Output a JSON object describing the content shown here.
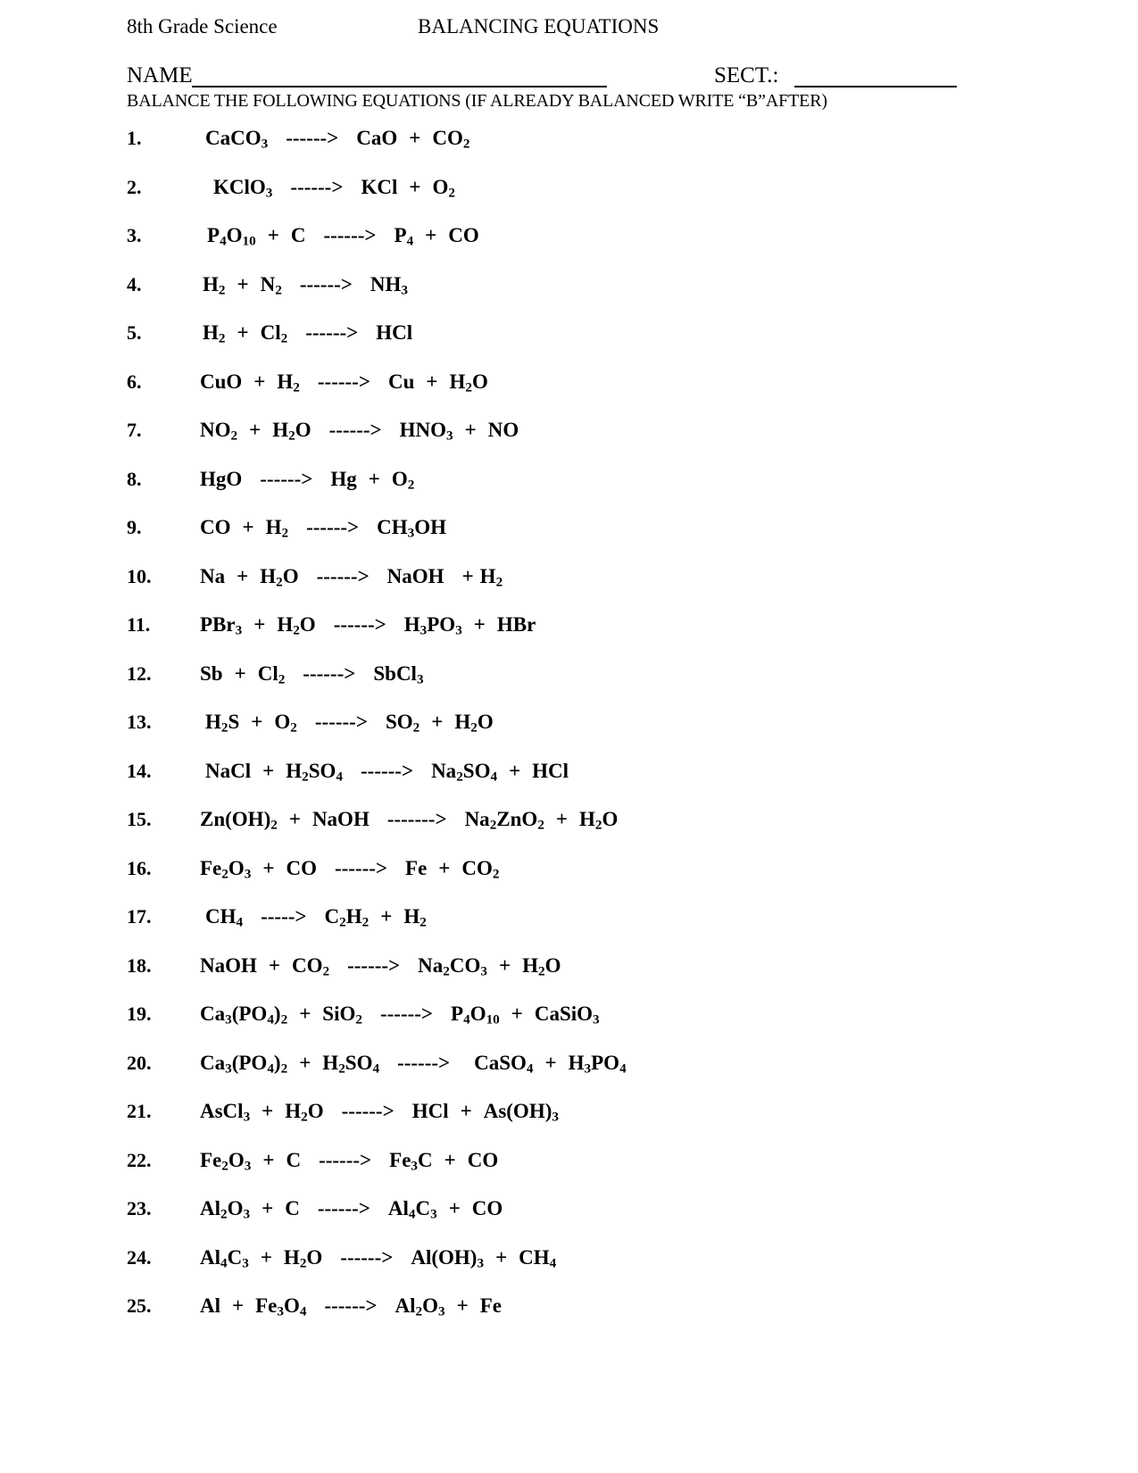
{
  "header": {
    "course": "8th Grade Science",
    "title": "BALANCING EQUATIONS",
    "name_label": "NAME",
    "sect_label": "SECT.:",
    "instructions": "BALANCE THE FOLLOWING EQUATIONS (IF ALREADY BALANCED WRITE “B”AFTER)"
  },
  "equations": [
    {
      "num": "1.",
      "indent": 88,
      "arrow": "------>",
      "html": "CaCO<sub>3</sub><span class=\"sp-lg\"></span><span class=\"arrow\">------&gt;</span><span class=\"sp-lg\"></span>CaO<span class=\"sp\"></span>+<span class=\"sp\"></span>CO<sub>2</sub>",
      "text": "CaCO3 ------> CaO + CO2"
    },
    {
      "num": "2.",
      "indent": 97,
      "arrow": "------>",
      "html": "KClO<sub>3</sub><span class=\"sp-lg\"></span><span class=\"arrow\">------&gt;</span><span class=\"sp-lg\"></span>KCl<span class=\"sp\"></span>+<span class=\"sp\"></span>O<sub>2</sub>",
      "text": "KClO3 ------> KCl + O2"
    },
    {
      "num": "3.",
      "indent": 90,
      "arrow": "------>",
      "html": "P<sub>4</sub>O<sub>10</sub><span class=\"sp\"></span>+<span class=\"sp\"></span>C<span class=\"sp-lg\"></span><span class=\"arrow\">------&gt;</span><span class=\"sp-lg\"></span>P<sub>4</sub><span class=\"sp\"></span>+<span class=\"sp\"></span>CO",
      "text": "P4O10 + C ------> P4 + CO"
    },
    {
      "num": "4.",
      "indent": 85,
      "arrow": "------>",
      "html": "H<sub>2</sub><span class=\"sp\"></span>+<span class=\"sp\"></span>N<sub>2</sub><span class=\"sp-lg\"></span><span class=\"arrow\">------&gt;</span><span class=\"sp-lg\"></span>NH<sub>3</sub>",
      "text": "H2 + N2 ------> NH3"
    },
    {
      "num": "5.",
      "indent": 85,
      "arrow": "------>",
      "html": "H<sub>2</sub><span class=\"sp\"></span>+<span class=\"sp\"></span>Cl<sub>2</sub><span class=\"sp-lg\"></span><span class=\"arrow\">------&gt;</span><span class=\"sp-lg\"></span>HCl",
      "text": "H2 + Cl2 ------> HCl"
    },
    {
      "num": "6.",
      "indent": 82,
      "arrow": "------>",
      "html": "CuO<span class=\"sp\"></span>+<span class=\"sp\"></span>H<sub>2</sub><span class=\"sp-lg\"></span><span class=\"arrow\">------&gt;</span><span class=\"sp-lg\"></span>Cu<span class=\"sp\"></span>+<span class=\"sp\"></span>H<sub>2</sub>O",
      "text": "CuO + H2 ------> Cu + H2O"
    },
    {
      "num": "7.",
      "indent": 82,
      "arrow": "------>",
      "html": "NO<sub>2</sub><span class=\"sp\"></span>+<span class=\"sp\"></span>H<sub>2</sub>O<span class=\"sp-lg\"></span><span class=\"arrow\">------&gt;</span><span class=\"sp-lg\"></span>HNO<sub>3</sub><span class=\"sp\"></span>+<span class=\"sp\"></span>NO",
      "text": "NO2 + H2O ------> HNO3 + NO"
    },
    {
      "num": "8.",
      "indent": 82,
      "arrow": "------>",
      "html": "HgO<span class=\"sp-lg\"></span><span class=\"arrow\">------&gt;</span><span class=\"sp-lg\"></span>Hg<span class=\"sp\"></span>+<span class=\"sp\"></span>O<sub>2</sub>",
      "text": "HgO ------> Hg + O2"
    },
    {
      "num": "9.",
      "indent": 82,
      "arrow": "------>",
      "html": "CO<span class=\"sp\"></span>+<span class=\"sp\"></span>H<sub>2</sub><span class=\"sp-lg\"></span><span class=\"arrow\">------&gt;</span><span class=\"sp-lg\"></span>CH<sub>3</sub>OH",
      "text": "CO + H2 ------> CH3OH"
    },
    {
      "num": "10.",
      "indent": 82,
      "arrow": "------>",
      "html": "Na<span class=\"sp\"></span>+<span class=\"sp\"></span>H<sub>2</sub>O<span class=\"sp-lg\"></span><span class=\"arrow\">------&gt;</span><span class=\"sp-lg\"></span>NaOH<span class=\"sp-lg\"></span>+<span class=\"sp-sm\"></span>H<sub>2</sub>",
      "text": "Na + H2O ------> NaOH + H2"
    },
    {
      "num": "11.",
      "indent": 82,
      "arrow": "------>",
      "html": "PBr<sub>3</sub><span class=\"sp\"></span>+<span class=\"sp\"></span>H<sub>2</sub>O<span class=\"sp-lg\"></span><span class=\"arrow\">------&gt;</span><span class=\"sp-lg\"></span>H<sub>3</sub>PO<sub>3</sub><span class=\"sp\"></span>+<span class=\"sp\"></span>HBr",
      "text": "PBr3 + H2O ------> H3PO3 + HBr"
    },
    {
      "num": "12.",
      "indent": 82,
      "arrow": "------>",
      "html": "Sb<span class=\"sp\"></span>+<span class=\"sp\"></span>Cl<sub>2</sub><span class=\"sp-lg\"></span><span class=\"arrow\">------&gt;</span><span class=\"sp-lg\"></span>SbCl<sub>3</sub>",
      "text": "Sb + Cl2 ------> SbCl3"
    },
    {
      "num": "13.",
      "indent": 88,
      "arrow": "------>",
      "html": "H<sub>2</sub>S<span class=\"sp\"></span>+<span class=\"sp\"></span>O<sub>2</sub><span class=\"sp-lg\"></span><span class=\"arrow\">------&gt;</span><span class=\"sp-lg\"></span>SO<sub>2</sub><span class=\"sp\"></span>+<span class=\"sp\"></span>H<sub>2</sub>O",
      "text": "H2S + O2 ------> SO2 + H2O"
    },
    {
      "num": "14.",
      "indent": 88,
      "arrow": "------>",
      "html": "NaCl<span class=\"sp\"></span>+<span class=\"sp\"></span>H<sub>2</sub>SO<sub>4</sub><span class=\"sp-lg\"></span><span class=\"arrow\">------&gt;</span><span class=\"sp-lg\"></span>Na<sub>2</sub>SO<sub>4</sub><span class=\"sp\"></span>+<span class=\"sp\"></span>HCl",
      "text": "NaCl + H2SO4 ------> Na2SO4 + HCl"
    },
    {
      "num": "15.",
      "indent": 82,
      "arrow": "------->",
      "html": "Zn(OH)<sub>2</sub><span class=\"sp\"></span>+<span class=\"sp\"></span>NaOH<span class=\"sp-lg\"></span><span class=\"arrow\">-------&gt;</span><span class=\"sp-lg\"></span>Na<sub>2</sub>ZnO<sub>2</sub><span class=\"sp\"></span>+<span class=\"sp\"></span>H<sub>2</sub>O",
      "text": "Zn(OH)2 + NaOH -------> Na2ZnO2 + H2O"
    },
    {
      "num": "16.",
      "indent": 82,
      "arrow": "------>",
      "html": "Fe<sub>2</sub>O<sub>3</sub><span class=\"sp\"></span>+<span class=\"sp\"></span>CO<span class=\"sp-lg\"></span><span class=\"arrow\">------&gt;</span><span class=\"sp-lg\"></span>Fe<span class=\"sp\"></span>+<span class=\"sp\"></span>CO<sub>2</sub>",
      "text": "Fe2O3 + CO ------> Fe + CO2"
    },
    {
      "num": "17.",
      "indent": 88,
      "arrow": "----->",
      "html": "CH<sub>4</sub><span class=\"sp-lg\"></span><span class=\"arrow\">-----&gt;</span><span class=\"sp-lg\"></span>C<sub>2</sub>H<sub>2</sub><span class=\"sp\"></span>+<span class=\"sp\"></span>H<sub>2</sub>",
      "text": "CH4 -----> C2H2 + H2"
    },
    {
      "num": "18.",
      "indent": 82,
      "arrow": "------>",
      "html": "NaOH<span class=\"sp\"></span>+<span class=\"sp\"></span>CO<sub>2</sub><span class=\"sp-lg\"></span><span class=\"arrow\">------&gt;</span><span class=\"sp-lg\"></span>Na<sub>2</sub>CO<sub>3</sub><span class=\"sp\"></span>+<span class=\"sp\"></span>H<sub>2</sub>O",
      "text": "NaOH + CO2 ------> Na2CO3 + H2O"
    },
    {
      "num": "19.",
      "indent": 82,
      "arrow": "------>",
      "html": "Ca<sub>3</sub>(PO<sub>4</sub>)<sub>2</sub><span class=\"sp\"></span>+<span class=\"sp\"></span>SiO<sub>2</sub><span class=\"sp-lg\"></span><span class=\"arrow\">------&gt;</span><span class=\"sp-lg\"></span>P<sub>4</sub>O<sub>10</sub><span class=\"sp\"></span>+<span class=\"sp\"></span>CaSiO<sub>3</sub>",
      "text": "Ca3(PO4)2 + SiO2 ------> P4O10 + CaSiO3"
    },
    {
      "num": "20.",
      "indent": 82,
      "arrow": "------>",
      "html": "Ca<sub>3</sub>(PO<sub>4</sub>)<sub>2</sub><span class=\"sp\"></span>+<span class=\"sp\"></span>H<sub>2</sub>SO<sub>4</sub><span class=\"sp-lg\"></span><span class=\"arrow\">------&gt;</span><span class=\"sp-lg\"></span><span class=\"sp-sm\"></span>CaSO<sub>4</sub><span class=\"sp\"></span>+<span class=\"sp\"></span>H<sub>3</sub>PO<sub>4</sub>",
      "text": "Ca3(PO4)2 + H2SO4 ------> CaSO4 + H3PO4"
    },
    {
      "num": "21.",
      "indent": 82,
      "arrow": "------>",
      "html": "AsCl<sub>3</sub><span class=\"sp\"></span>+<span class=\"sp\"></span>H<sub>2</sub>O<span class=\"sp-lg\"></span><span class=\"arrow\">------&gt;</span><span class=\"sp-lg\"></span>HCl<span class=\"sp\"></span>+<span class=\"sp\"></span>As(OH)<sub>3</sub>",
      "text": "AsCl3 + H2O ------> HCl + As(OH)3"
    },
    {
      "num": "22.",
      "indent": 82,
      "arrow": "------>",
      "html": "Fe<sub>2</sub>O<sub>3</sub><span class=\"sp\"></span>+<span class=\"sp\"></span>C<span class=\"sp-lg\"></span><span class=\"arrow\">------&gt;</span><span class=\"sp-lg\"></span>Fe<sub>3</sub>C<span class=\"sp\"></span>+<span class=\"sp\"></span>CO",
      "text": "Fe2O3 + C ------> Fe3C + CO"
    },
    {
      "num": "23.",
      "indent": 82,
      "arrow": "------>",
      "html": "Al<sub>2</sub>O<sub>3</sub><span class=\"sp\"></span>+<span class=\"sp\"></span>C<span class=\"sp-lg\"></span><span class=\"arrow\">------&gt;</span><span class=\"sp-lg\"></span>Al<sub>4</sub>C<sub>3</sub><span class=\"sp\"></span>+<span class=\"sp\"></span>CO",
      "text": "Al2O3 + C ------> Al4C3 + CO"
    },
    {
      "num": "24.",
      "indent": 82,
      "arrow": "------>",
      "html": "Al<sub>4</sub>C<sub>3</sub><span class=\"sp\"></span>+<span class=\"sp\"></span>H<sub>2</sub>O<span class=\"sp-lg\"></span><span class=\"arrow\">------&gt;</span><span class=\"sp-lg\"></span>Al(OH)<sub>3</sub><span class=\"sp\"></span>+<span class=\"sp\"></span>CH<sub>4</sub>",
      "text": "Al4C3 + H2O ------> Al(OH)3 + CH4"
    },
    {
      "num": "25.",
      "indent": 82,
      "arrow": "------>",
      "html": "Al<span class=\"sp\"></span>+<span class=\"sp\"></span>Fe<sub>3</sub>O<sub>4</sub><span class=\"sp-lg\"></span><span class=\"arrow\">------&gt;</span><span class=\"sp-lg\"></span>Al<sub>2</sub>O<sub>3</sub><span class=\"sp\"></span>+<span class=\"sp\"></span>Fe",
      "text": "Al + Fe3O4 ------> Al2O3 + Fe"
    }
  ]
}
